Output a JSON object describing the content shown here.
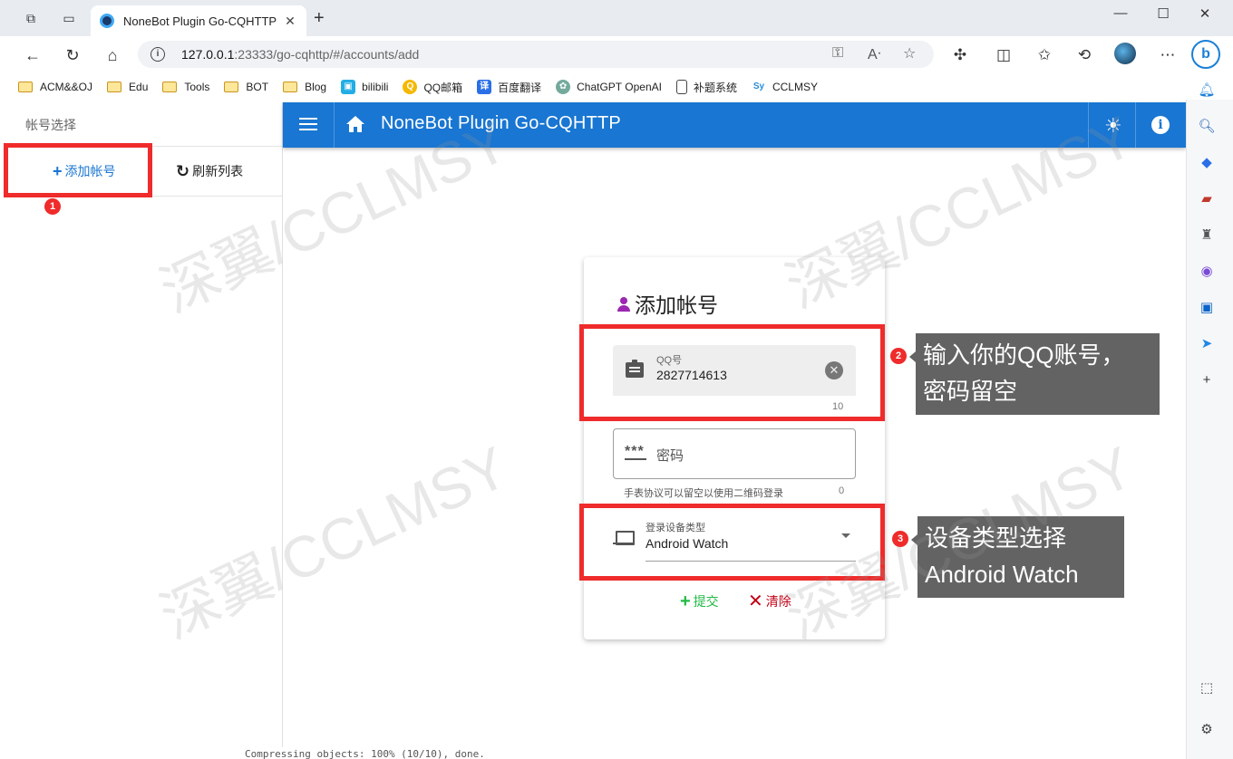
{
  "browser": {
    "tab_title": "NoneBot Plugin Go-CQHTTP",
    "url_host": "127.0.0.1",
    "url_rest": ":23333/go-cqhttp/#/accounts/add",
    "bookmarks": [
      {
        "label": "ACM&&OJ",
        "icon": "folder-icon"
      },
      {
        "label": "Edu",
        "icon": "folder-icon"
      },
      {
        "label": "Tools",
        "icon": "folder-icon"
      },
      {
        "label": "BOT",
        "icon": "folder-icon"
      },
      {
        "label": "Blog",
        "icon": "folder-icon"
      },
      {
        "label": "bilibili",
        "icon": "bilibili-icon"
      },
      {
        "label": "QQ邮箱",
        "icon": "qqmail-icon"
      },
      {
        "label": "百度翻译",
        "icon": "baidu-translate-icon"
      },
      {
        "label": "ChatGPT OpenAI",
        "icon": "openai-icon"
      },
      {
        "label": "补题系统",
        "icon": "document-icon"
      },
      {
        "label": "CCLMSY",
        "icon": "cclmsy-icon"
      }
    ]
  },
  "drawer": {
    "title": "帐号选择",
    "add_label": "添加帐号",
    "refresh_label": "刷新列表"
  },
  "appbar": {
    "title": "NoneBot Plugin Go-CQHTTP"
  },
  "form": {
    "title": "添加帐号",
    "qq_label": "QQ号",
    "qq_value": "2827714613",
    "qq_counter": "10",
    "password_placeholder": "密码",
    "password_hint": "手表协议可以留空以使用二维码登录",
    "password_counter": "0",
    "device_label": "登录设备类型",
    "device_value": "Android Watch",
    "submit_label": "提交",
    "clear_label": "清除"
  },
  "annotations": {
    "badge1": "1",
    "badge2": "2",
    "badge3": "3",
    "callout2_line1": "输入你的QQ账号，",
    "callout2_line2": "密码留空",
    "callout3_line1": "设备类型选择",
    "callout3_line2": "Android Watch",
    "watermark": "深翼/CCLMSY"
  },
  "terminal_text": "Compressing objects: 100% (10/10), done.",
  "colors": {
    "primary": "#1976d2",
    "positive": "#21ba45",
    "negative": "#c10015",
    "annotation_red": "#ef2b2b",
    "callout_bg": "#636363"
  }
}
